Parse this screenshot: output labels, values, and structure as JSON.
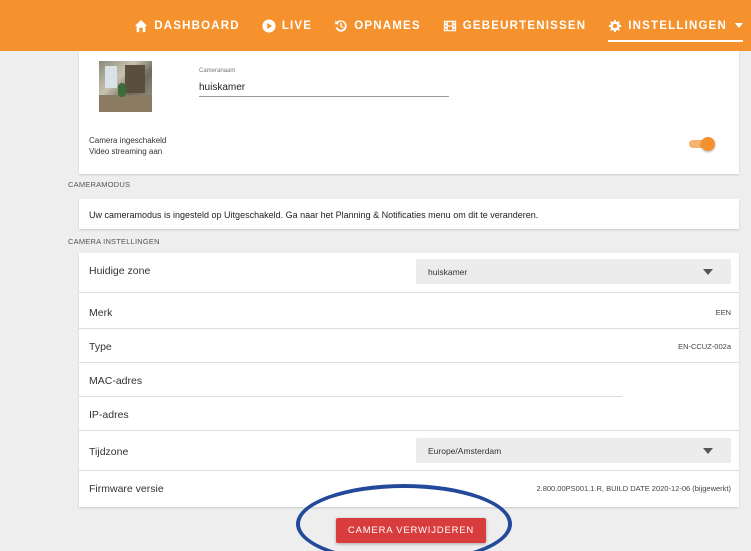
{
  "nav": {
    "items": [
      {
        "label": "DASHBOARD",
        "icon": "home-icon"
      },
      {
        "label": "LIVE",
        "icon": "play-circle-icon"
      },
      {
        "label": "OPNAMES",
        "icon": "history-icon"
      },
      {
        "label": "GEBEURTENISSEN",
        "icon": "film-icon"
      },
      {
        "label": "INSTELLINGEN",
        "icon": "gear-icon"
      }
    ],
    "active": "INSTELLINGEN",
    "bg_color": "#f5922e"
  },
  "camera": {
    "name_label": "Cameranaam",
    "name_value": "huiskamer",
    "status_line1": "Camera ingeschakeld",
    "status_line2": "Video streaming aan",
    "toggle_on": true
  },
  "sections": {
    "mode": "CAMERAMODUS",
    "settings": "CAMERA INSTELLINGEN"
  },
  "mode_message": "Uw cameramodus is ingesteld op Uitgeschakeld. Ga naar het Planning & Notificaties menu om dit te veranderen.",
  "settings": {
    "zone": {
      "label": "Huidige zone",
      "value": "huiskamer"
    },
    "brand": {
      "label": "Merk",
      "value": "EEN"
    },
    "type": {
      "label": "Type",
      "value": "EN-CCUZ-002a"
    },
    "mac": {
      "label": "MAC-adres",
      "value": ""
    },
    "ip": {
      "label": "IP-adres",
      "value": ""
    },
    "timezone": {
      "label": "Tijdzone",
      "value": "Europe/Amsterdam"
    },
    "firmware": {
      "label": "Firmware versie",
      "value": "2.800.00PS001.1.R, BUILD DATE 2020-12-06 (bijgewerkt)"
    }
  },
  "delete_button": "CAMERA VERWIJDEREN",
  "colors": {
    "accent": "#f5922e",
    "danger": "#d93c3c",
    "annotation": "#23499a"
  }
}
